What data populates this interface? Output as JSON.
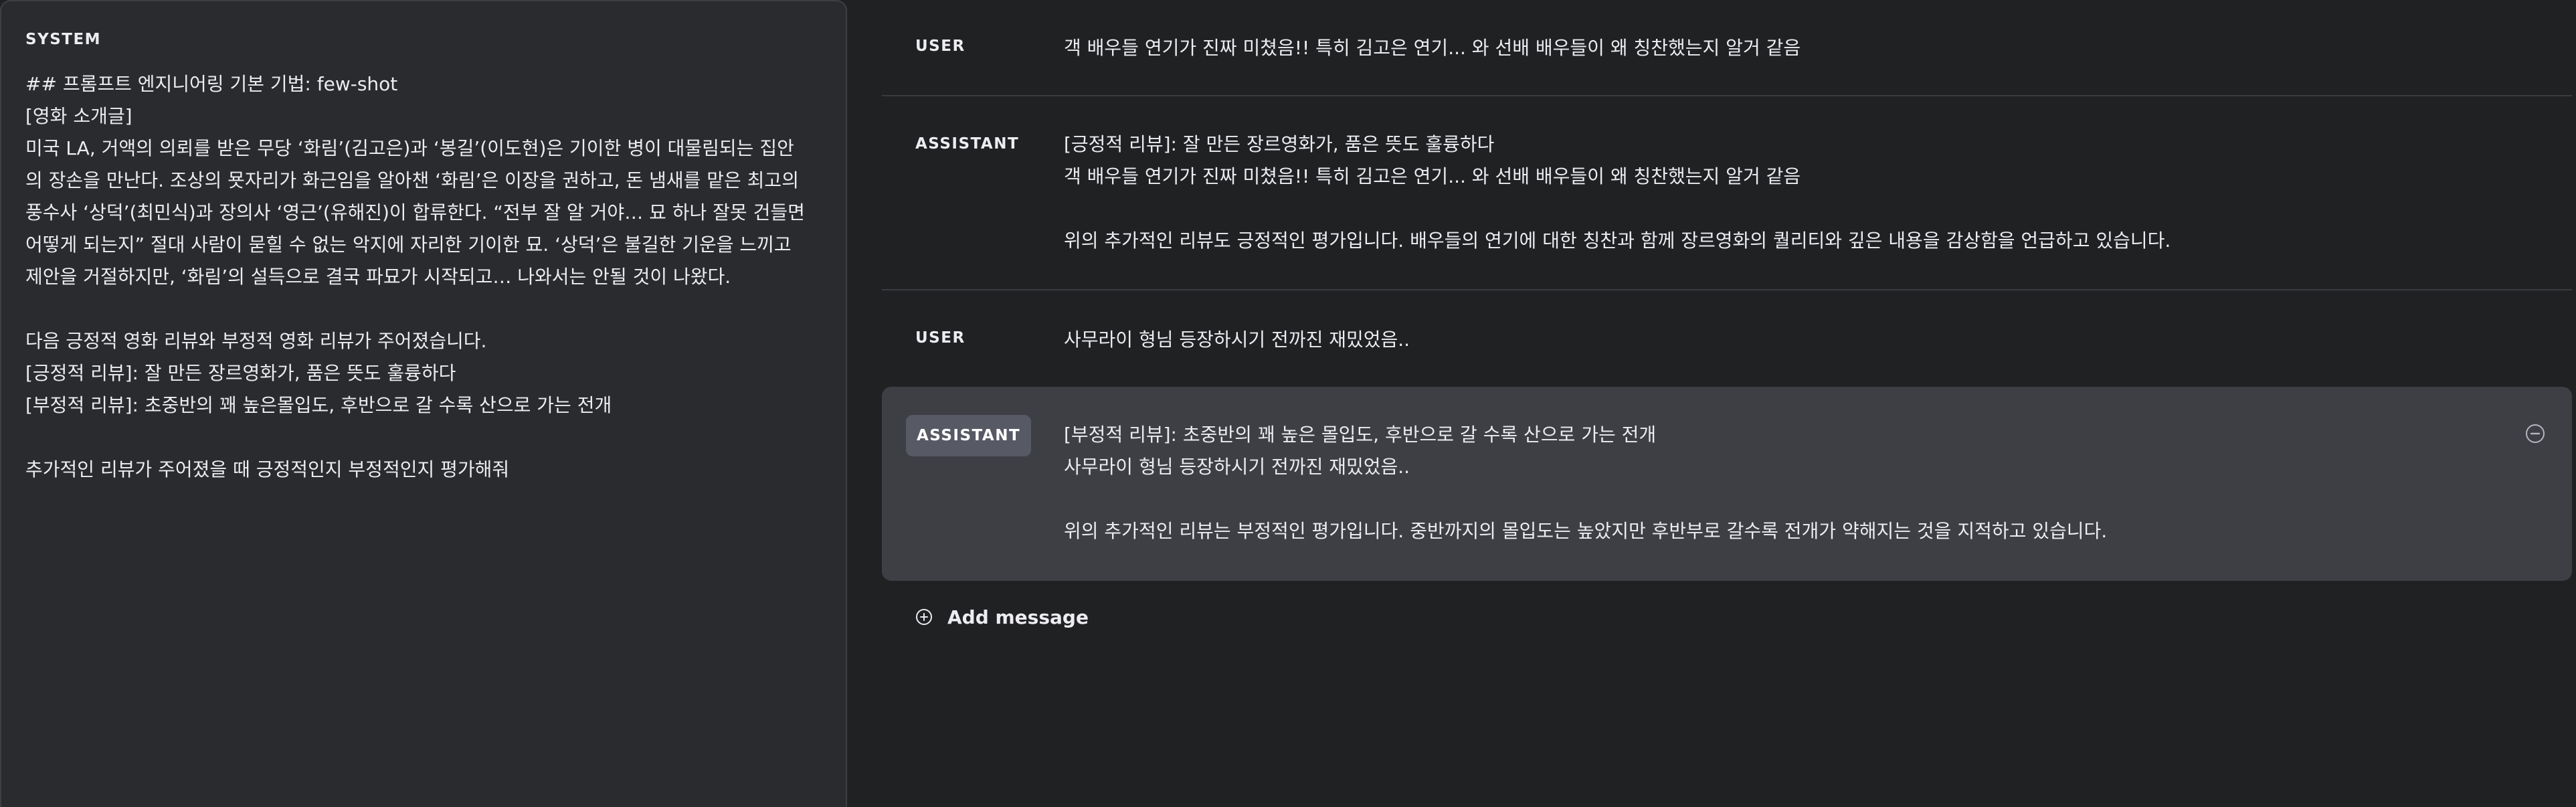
{
  "system": {
    "label": "SYSTEM",
    "lines": [
      "## 프롬프트 엔지니어링 기본 기법: few-shot",
      "[영화 소개글]",
      "미국 LA, 거액의 의뢰를 받은 무당 ‘화림’(김고은)과 ‘봉길’(이도현)은 기이한 병이 대물림되는 집안",
      "의 장손을 만난다. 조상의 묫자리가 화근임을 알아챈 ‘화림’은 이장을 권하고, 돈 냄새를 맡은 최고의",
      "풍수사 ‘상덕’(최민식)과 장의사 ‘영근’(유해진)이 합류한다. “전부 잘 알 거야… 묘 하나 잘못 건들면",
      "어떻게 되는지” 절대 사람이 묻힐 수 없는 악지에 자리한 기이한 묘. ‘상덕’은 불길한 기운을 느끼고",
      "제안을 거절하지만, ‘화림’의 설득으로 결국 파묘가 시작되고… 나와서는 안될 것이 나왔다.",
      "",
      "다음 긍정적 영화 리뷰와 부정적 영화 리뷰가 주어졌습니다.",
      "[긍정적 리뷰]: 잘 만든 장르영화가, 품은 뜻도 훌륭하다",
      "[부정적 리뷰]: 초중반의 꽤 높은몰입도, 후반으로 갈 수록 산으로 가는 전개",
      "",
      "추가적인 리뷰가 주어졌을 때 긍정적인지 부정적인지 평가해줘"
    ]
  },
  "messages": [
    {
      "role": "USER",
      "lines": [
        "객 배우들 연기가 진짜 미쳤음!! 특히 김고은 연기... 와 선배 배우들이 왜 칭찬했는지 알거 같음"
      ]
    },
    {
      "role": "ASSISTANT",
      "lines": [
        "[긍정적 리뷰]: 잘 만든 장르영화가, 품은 뜻도 훌륭하다",
        "객 배우들 연기가 진짜 미쳤음!! 특히 김고은 연기... 와 선배 배우들이 왜 칭찬했는지 알거 같음",
        "",
        "위의 추가적인 리뷰도 긍정적인 평가입니다. 배우들의 연기에 대한 칭찬과 함께 장르영화의 퀄리티와 깊은 내용을 감상함을 언급하고 있습니다."
      ]
    },
    {
      "role": "USER",
      "lines": [
        "사무라이 형님 등장하시기 전까진 재밌었음.."
      ]
    },
    {
      "role": "ASSISTANT",
      "lines": [
        "[부정적 리뷰]: 초중반의 꽤 높은 몰입도, 후반으로 갈 수록 산으로 가는 전개",
        "사무라이 형님 등장하시기 전까진 재밌었음..",
        "",
        "위의 추가적인 리뷰는 부정적인 평가입니다. 중반까지의 몰입도는 높았지만 후반부로 갈수록 전개가 약해지는 것을 지적하고 있습니다."
      ]
    }
  ],
  "add_message": {
    "label": "Add message",
    "icon": "plus-circle-icon"
  },
  "icons": {
    "remove": "minus-circle-icon"
  },
  "colors": {
    "background": "#202123",
    "panel": "#2a2b2e",
    "active_message": "#3e3f45",
    "role_pill": "#575965",
    "text": "#ececf1"
  }
}
